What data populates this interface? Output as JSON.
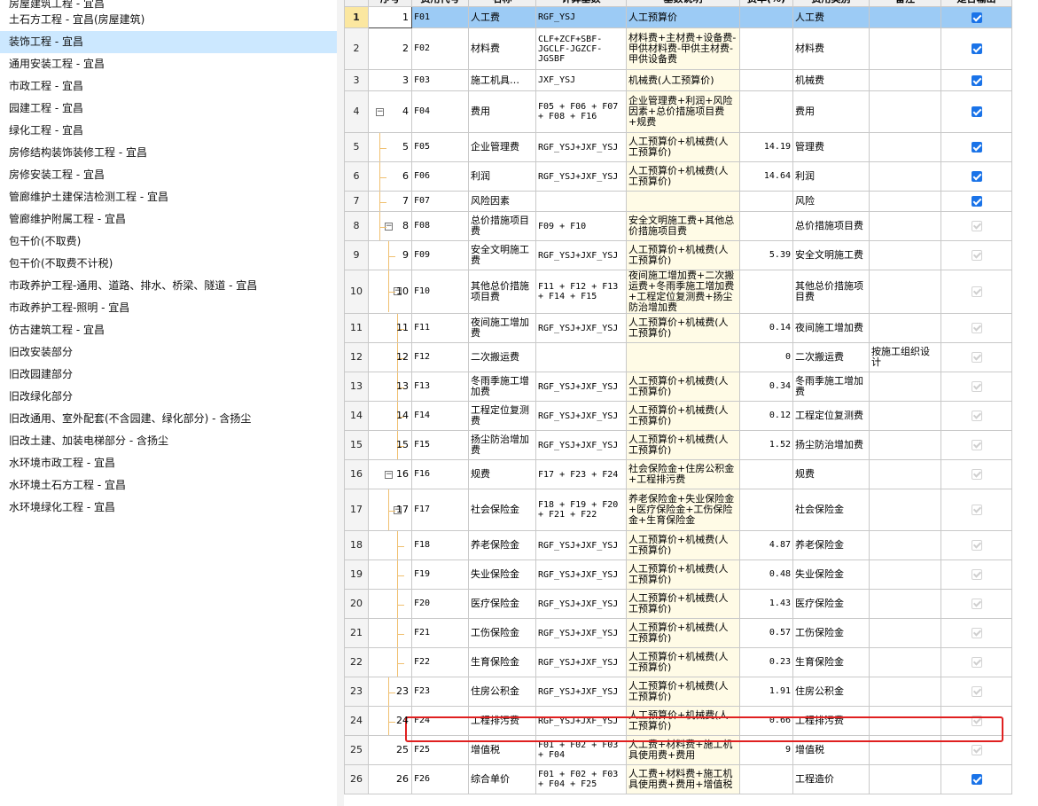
{
  "left_tree": {
    "items": [
      {
        "label": "房屋建筑工程 - 宜昌",
        "selected": false
      },
      {
        "label": "土石方工程 - 宜昌(房屋建筑)",
        "selected": false
      },
      {
        "label": "装饰工程 - 宜昌",
        "selected": true
      },
      {
        "label": "通用安装工程 - 宜昌",
        "selected": false
      },
      {
        "label": "市政工程 - 宜昌",
        "selected": false
      },
      {
        "label": "园建工程 - 宜昌",
        "selected": false
      },
      {
        "label": "绿化工程 - 宜昌",
        "selected": false
      },
      {
        "label": "房修结构装饰装修工程 - 宜昌",
        "selected": false
      },
      {
        "label": "房修安装工程 - 宜昌",
        "selected": false
      },
      {
        "label": "管廊维护土建保洁检测工程 - 宜昌",
        "selected": false
      },
      {
        "label": "管廊维护附属工程 - 宜昌",
        "selected": false
      },
      {
        "label": "包干价(不取费)",
        "selected": false
      },
      {
        "label": "包干价(不取费不计税)",
        "selected": false
      },
      {
        "label": "市政养护工程-通用、道路、排水、桥梁、隧道 - 宜昌",
        "selected": false
      },
      {
        "label": "市政养护工程-照明 - 宜昌",
        "selected": false
      },
      {
        "label": "仿古建筑工程 - 宜昌",
        "selected": false
      },
      {
        "label": "旧改安装部分",
        "selected": false
      },
      {
        "label": "旧改园建部分",
        "selected": false
      },
      {
        "label": "旧改绿化部分",
        "selected": false
      },
      {
        "label": "旧改通用、室外配套(不含园建、绿化部分) - 含扬尘",
        "selected": false
      },
      {
        "label": "旧改土建、加装电梯部分 - 含扬尘",
        "selected": false
      },
      {
        "label": "水环境市政工程 - 宜昌",
        "selected": false
      },
      {
        "label": "水环境土石方工程 - 宜昌",
        "selected": false
      },
      {
        "label": "水环境绿化工程 - 宜昌",
        "selected": false
      }
    ]
  },
  "grid": {
    "columns": [
      "",
      "序号",
      "费用代号",
      "名称",
      "计算基数",
      "基数说明",
      "费率(%)",
      "费用类别",
      "备注",
      "是否输出"
    ],
    "rows": [
      {
        "rn": "1",
        "ser": "1",
        "code": "F01",
        "name": "人工费",
        "base": "RGF_YSJ",
        "desc": "人工预算价",
        "rate": "",
        "cat": "人工费",
        "note": "",
        "chk": "on"
      },
      {
        "rn": "2",
        "ser": "2",
        "code": "F02",
        "name": "材料费",
        "base": "CLF+ZCF+SBF-JGCLF-JGZCF-JGSBF",
        "desc": "材料费+主材费+设备费-甲供材料费-甲供主材费-甲供设备费",
        "rate": "",
        "cat": "材料费",
        "note": "",
        "chk": "on"
      },
      {
        "rn": "3",
        "ser": "3",
        "code": "F03",
        "name": "施工机具…",
        "base": "JXF_YSJ",
        "desc": "机械费(人工预算价)",
        "rate": "",
        "cat": "机械费",
        "note": "",
        "chk": "on"
      },
      {
        "rn": "4",
        "ser": "4",
        "code": "F04",
        "name": "费用",
        "base": "F05 + F06 + F07 + F08 + F16",
        "desc": "企业管理费+利润+风险因素+总价措施项目费+规费",
        "rate": "",
        "cat": "费用",
        "note": "",
        "chk": "on"
      },
      {
        "rn": "5",
        "ser": "5",
        "code": "F05",
        "name": "企业管理费",
        "base": "RGF_YSJ+JXF_YSJ",
        "desc": "人工预算价+机械费(人工预算价)",
        "rate": "14.19",
        "cat": "管理费",
        "note": "",
        "chk": "on"
      },
      {
        "rn": "6",
        "ser": "6",
        "code": "F06",
        "name": "利润",
        "base": "RGF_YSJ+JXF_YSJ",
        "desc": "人工预算价+机械费(人工预算价)",
        "rate": "14.64",
        "cat": "利润",
        "note": "",
        "chk": "on"
      },
      {
        "rn": "7",
        "ser": "7",
        "code": "F07",
        "name": "风险因素",
        "base": "",
        "desc": "",
        "rate": "",
        "cat": "风险",
        "note": "",
        "chk": "on"
      },
      {
        "rn": "8",
        "ser": "8",
        "code": "F08",
        "name": "总价措施项目费",
        "base": "F09 + F10",
        "desc": "安全文明施工费+其他总价措施项目费",
        "rate": "",
        "cat": "总价措施项目费",
        "note": "",
        "chk": "dis"
      },
      {
        "rn": "9",
        "ser": "9",
        "code": "F09",
        "name": "安全文明施工费",
        "base": "RGF_YSJ+JXF_YSJ",
        "desc": "人工预算价+机械费(人工预算价)",
        "rate": "5.39",
        "cat": "安全文明施工费",
        "note": "",
        "chk": "dis"
      },
      {
        "rn": "10",
        "ser": "10",
        "code": "F10",
        "name": "其他总价措施项目费",
        "base": "F11 + F12 + F13 + F14 + F15",
        "desc": "夜间施工增加费+二次搬运费+冬雨季施工增加费+工程定位复测费+扬尘防治增加费",
        "rate": "",
        "cat": "其他总价措施项目费",
        "note": "",
        "chk": "dis"
      },
      {
        "rn": "11",
        "ser": "11",
        "code": "F11",
        "name": "夜间施工增加费",
        "base": "RGF_YSJ+JXF_YSJ",
        "desc": "人工预算价+机械费(人工预算价)",
        "rate": "0.14",
        "cat": "夜间施工增加费",
        "note": "",
        "chk": "dis"
      },
      {
        "rn": "12",
        "ser": "12",
        "code": "F12",
        "name": "二次搬运费",
        "base": "",
        "desc": "",
        "rate": "0",
        "cat": "二次搬运费",
        "note": "按施工组织设计",
        "chk": "dis"
      },
      {
        "rn": "13",
        "ser": "13",
        "code": "F13",
        "name": "冬雨季施工增加费",
        "base": "RGF_YSJ+JXF_YSJ",
        "desc": "人工预算价+机械费(人工预算价)",
        "rate": "0.34",
        "cat": "冬雨季施工增加费",
        "note": "",
        "chk": "dis"
      },
      {
        "rn": "14",
        "ser": "14",
        "code": "F14",
        "name": "工程定位复测费",
        "base": "RGF_YSJ+JXF_YSJ",
        "desc": "人工预算价+机械费(人工预算价)",
        "rate": "0.12",
        "cat": "工程定位复测费",
        "note": "",
        "chk": "dis"
      },
      {
        "rn": "15",
        "ser": "15",
        "code": "F15",
        "name": "扬尘防治增加费",
        "base": "RGF_YSJ+JXF_YSJ",
        "desc": "人工预算价+机械费(人工预算价)",
        "rate": "1.52",
        "cat": "扬尘防治增加费",
        "note": "",
        "chk": "dis"
      },
      {
        "rn": "16",
        "ser": "16",
        "code": "F16",
        "name": "规费",
        "base": "F17 + F23 + F24",
        "desc": "社会保险金+住房公积金+工程排污费",
        "rate": "",
        "cat": "规费",
        "note": "",
        "chk": "dis"
      },
      {
        "rn": "17",
        "ser": "17",
        "code": "F17",
        "name": "社会保险金",
        "base": "F18 + F19 + F20 + F21 + F22",
        "desc": "养老保险金+失业保险金+医疗保险金+工伤保险金+生育保险金",
        "rate": "",
        "cat": "社会保险金",
        "note": "",
        "chk": "dis"
      },
      {
        "rn": "18",
        "ser": "",
        "code": "F18",
        "name": "养老保险金",
        "base": "RGF_YSJ+JXF_YSJ",
        "desc": "人工预算价+机械费(人工预算价)",
        "rate": "4.87",
        "cat": "养老保险金",
        "note": "",
        "chk": "dis"
      },
      {
        "rn": "19",
        "ser": "",
        "code": "F19",
        "name": "失业保险金",
        "base": "RGF_YSJ+JXF_YSJ",
        "desc": "人工预算价+机械费(人工预算价)",
        "rate": "0.48",
        "cat": "失业保险金",
        "note": "",
        "chk": "dis"
      },
      {
        "rn": "20",
        "ser": "",
        "code": "F20",
        "name": "医疗保险金",
        "base": "RGF_YSJ+JXF_YSJ",
        "desc": "人工预算价+机械费(人工预算价)",
        "rate": "1.43",
        "cat": "医疗保险金",
        "note": "",
        "chk": "dis"
      },
      {
        "rn": "21",
        "ser": "",
        "code": "F21",
        "name": "工伤保险金",
        "base": "RGF_YSJ+JXF_YSJ",
        "desc": "人工预算价+机械费(人工预算价)",
        "rate": "0.57",
        "cat": "工伤保险金",
        "note": "",
        "chk": "dis"
      },
      {
        "rn": "22",
        "ser": "",
        "code": "F22",
        "name": "生育保险金",
        "base": "RGF_YSJ+JXF_YSJ",
        "desc": "人工预算价+机械费(人工预算价)",
        "rate": "0.23",
        "cat": "生育保险金",
        "note": "",
        "chk": "dis"
      },
      {
        "rn": "23",
        "ser": "23",
        "code": "F23",
        "name": "住房公积金",
        "base": "RGF_YSJ+JXF_YSJ",
        "desc": "人工预算价+机械费(人工预算价)",
        "rate": "1.91",
        "cat": "住房公积金",
        "note": "",
        "chk": "dis"
      },
      {
        "rn": "24",
        "ser": "24",
        "code": "F24",
        "name": "工程排污费",
        "base": "RGF_YSJ+JXF_YSJ",
        "desc": "人工预算价+机械费(人工预算价)",
        "rate": "0.66",
        "cat": "工程排污费",
        "note": "",
        "chk": "dis"
      },
      {
        "rn": "25",
        "ser": "25",
        "code": "F25",
        "name": "增值税",
        "base": "F01 + F02 + F03 + F04",
        "desc": "人工费+材料费+施工机具使用费+费用",
        "rate": "9",
        "cat": "增值税",
        "note": "",
        "chk": "dis"
      },
      {
        "rn": "26",
        "ser": "26",
        "code": "F26",
        "name": "综合单价",
        "base": "F01 + F02 + F03 + F04 + F25",
        "desc": "人工费+材料费+施工机具使用费+费用+增值税",
        "rate": "",
        "cat": "工程造价",
        "note": "",
        "chk": "on"
      }
    ]
  },
  "colors": {
    "selected_row": "#9ccbf5",
    "checkbox_on": "#1a73e8",
    "highlight_box": "#e02020",
    "tree_selected": "#cce8ff"
  }
}
